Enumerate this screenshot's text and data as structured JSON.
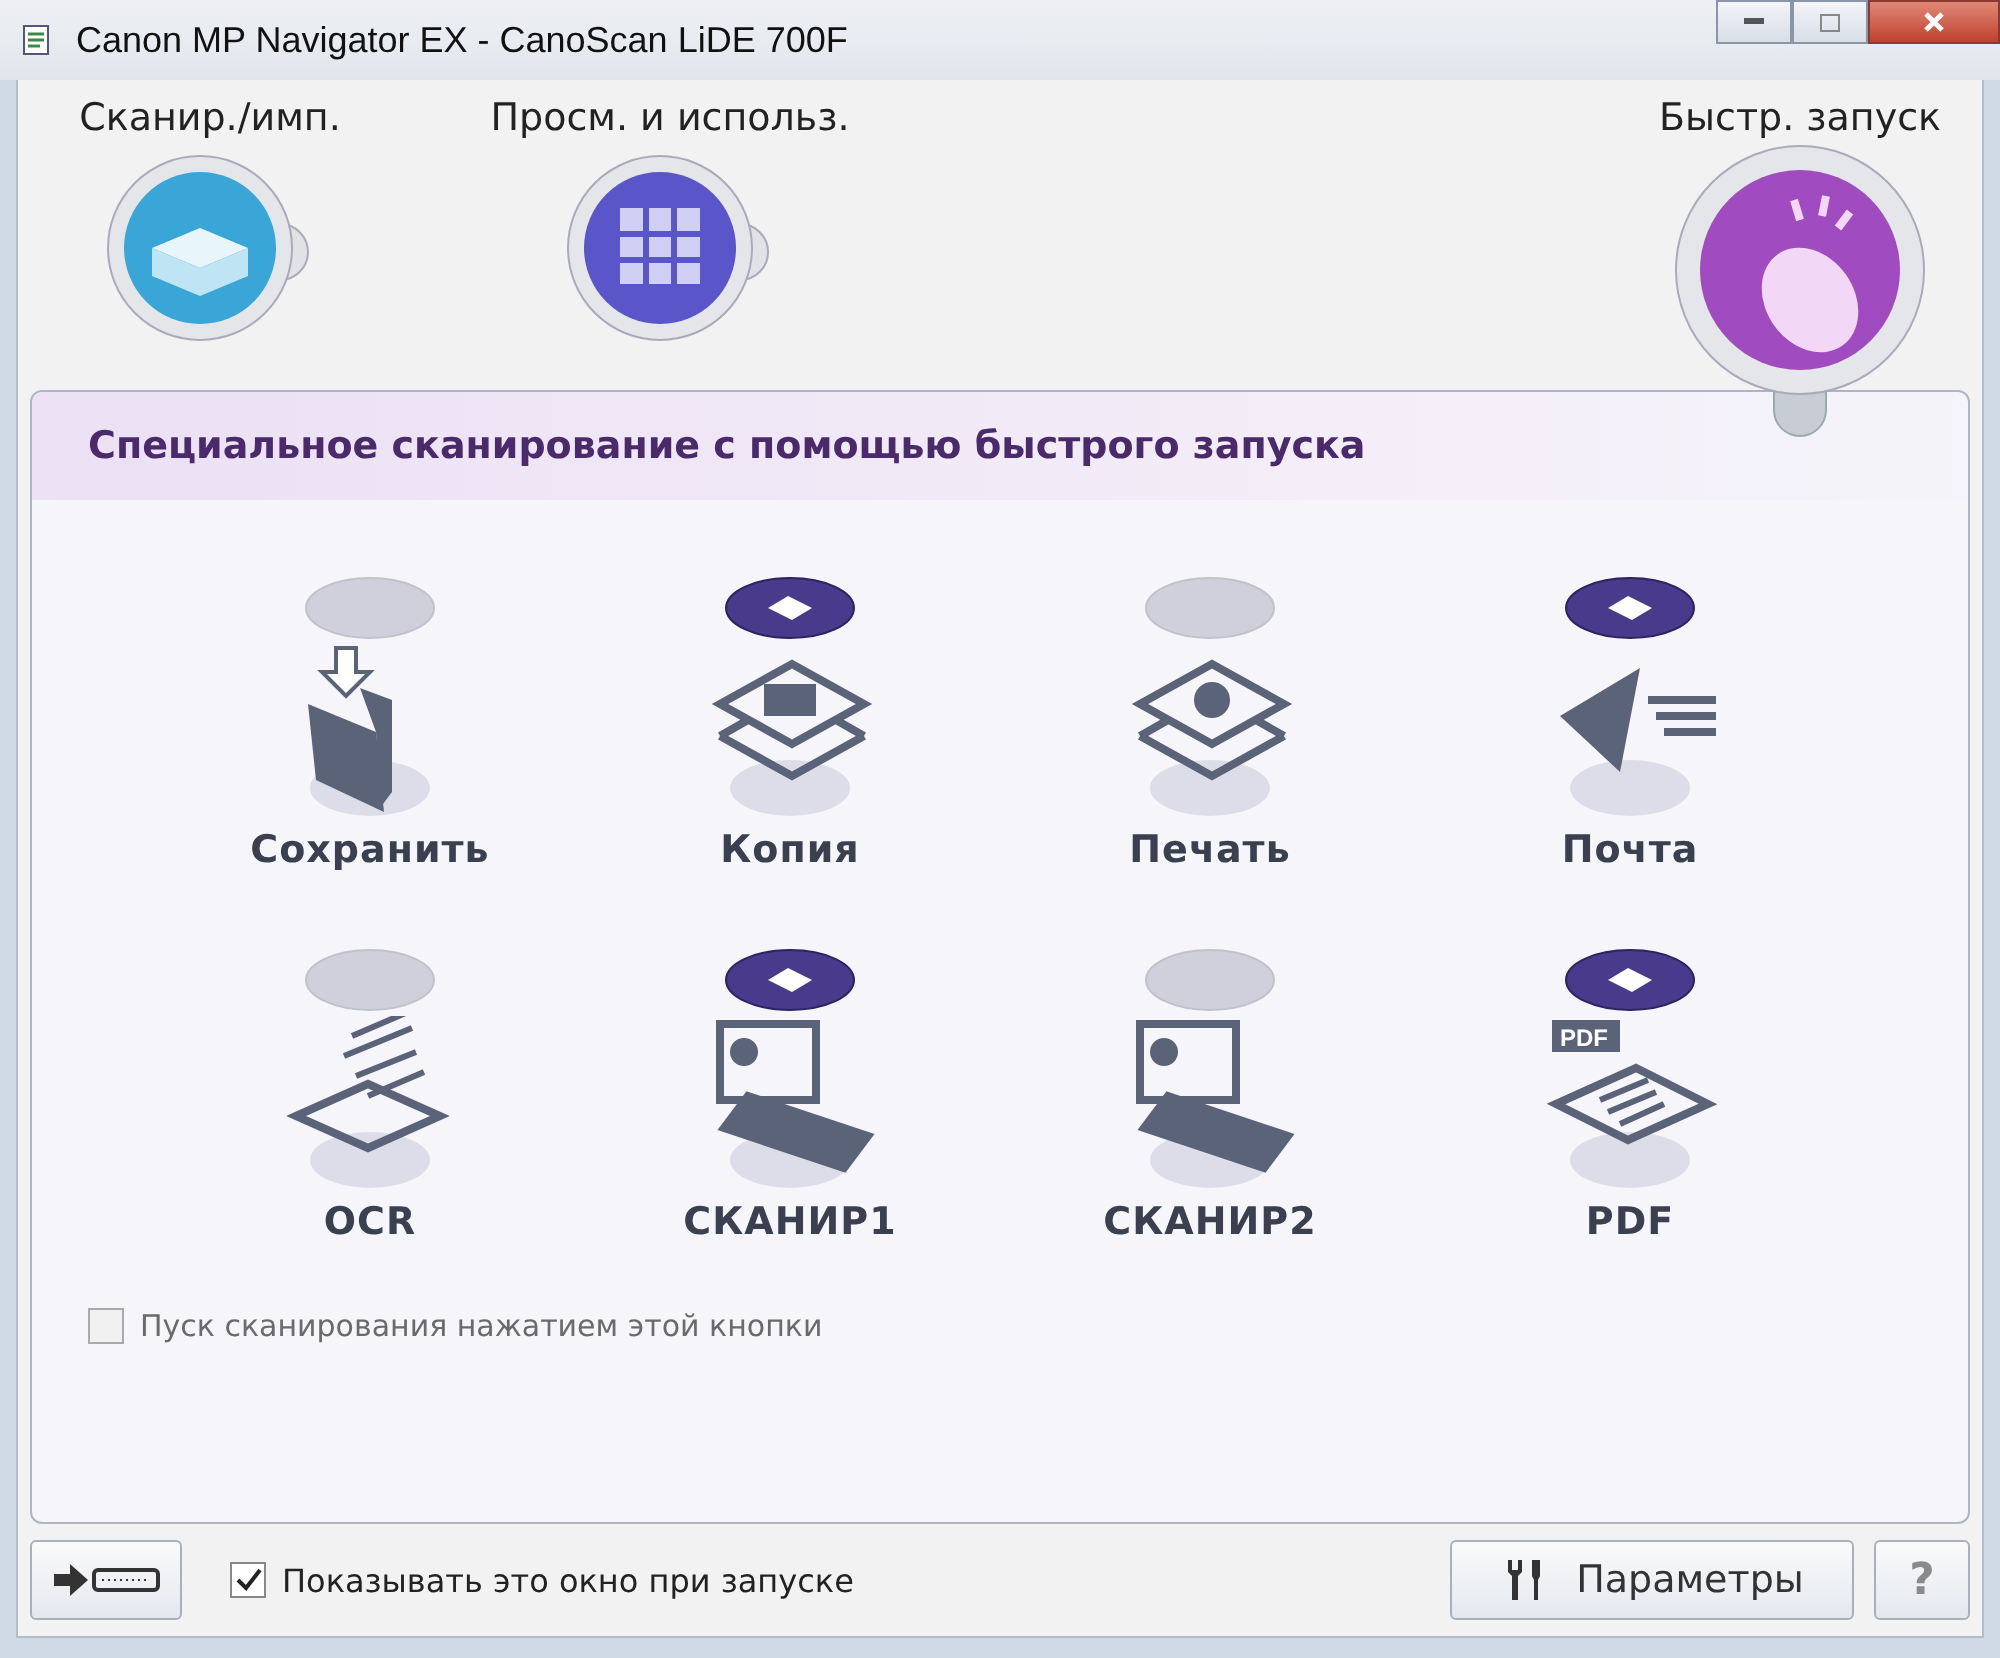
{
  "window": {
    "title": "Canon MP Navigator EX - CanoScan LiDE 700F"
  },
  "modes": [
    {
      "label": "Сканир./имп.",
      "kind": "scan",
      "selected": false
    },
    {
      "label": "Просм. и использ.",
      "kind": "view",
      "selected": false
    },
    {
      "label": "Быстр. запуск",
      "kind": "quick",
      "selected": true
    }
  ],
  "panel": {
    "title": "Специальное сканирование с помощью быстрого запуска",
    "items": [
      {
        "label": "Сохранить",
        "kind": "save",
        "assigned": false
      },
      {
        "label": "Копия",
        "kind": "copy",
        "assigned": true
      },
      {
        "label": "Печать",
        "kind": "print",
        "assigned": false
      },
      {
        "label": "Почта",
        "kind": "mail",
        "assigned": true
      },
      {
        "label": "OCR",
        "kind": "ocr",
        "assigned": false
      },
      {
        "label": "СКАНИР1",
        "kind": "scan1",
        "assigned": true
      },
      {
        "label": "СКАНИР2",
        "kind": "scan2",
        "assigned": false
      },
      {
        "label": "PDF",
        "kind": "pdf",
        "assigned": true,
        "icon_text": "PDF"
      }
    ],
    "start_scan_checkbox": {
      "label": "Пуск сканирования нажатием этой кнопки",
      "checked": false,
      "disabled": true
    }
  },
  "footer": {
    "show_window_checkbox": {
      "label": "Показывать это окно при запуске",
      "checked": true
    },
    "parameters_button": "Параметры",
    "help_button": {
      "label": "?",
      "disabled": true
    }
  }
}
